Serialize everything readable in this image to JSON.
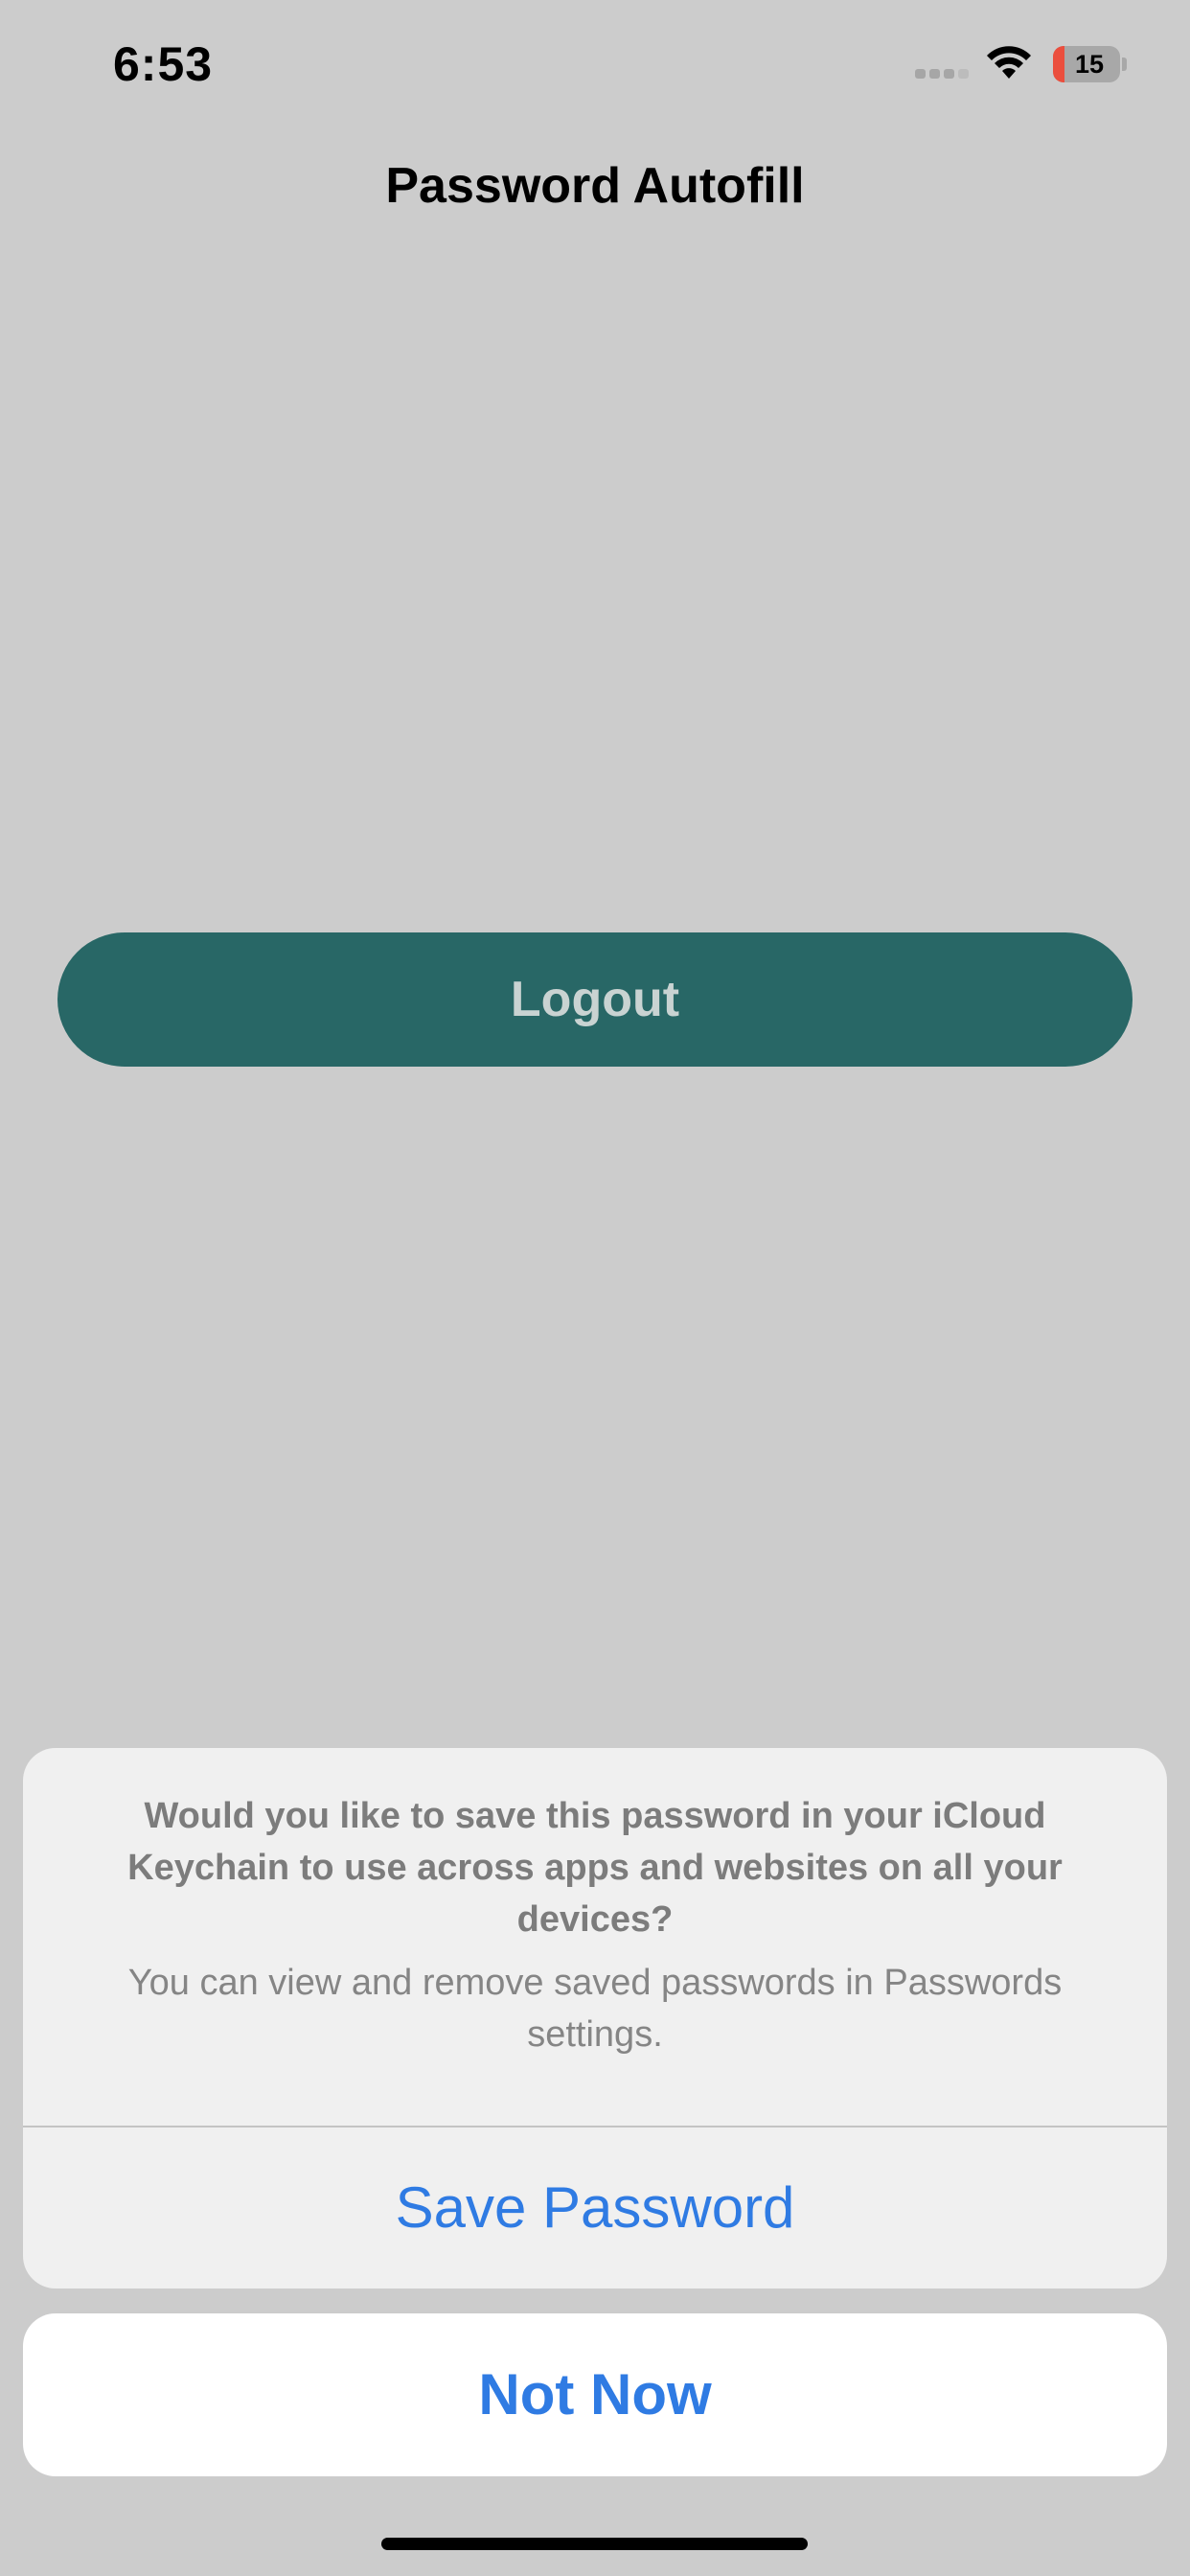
{
  "status_bar": {
    "time": "6:53",
    "battery_level": "15",
    "icons": [
      "signal-icon",
      "wifi-icon",
      "battery-icon"
    ]
  },
  "nav": {
    "title": "Password Autofill"
  },
  "main": {
    "logout_label": "Logout"
  },
  "action_sheet": {
    "title": "Would you like to save this password in your iCloud Keychain to use across apps and websites on all your devices?",
    "subtitle": "You can view and remove saved passwords in Passwords settings.",
    "save_label": "Save Password",
    "cancel_label": "Not Now"
  },
  "colors": {
    "background": "#cccccc",
    "logout_button": "#286766",
    "action_blue": "#2f7be3",
    "battery_low": "#eb4e3d"
  }
}
